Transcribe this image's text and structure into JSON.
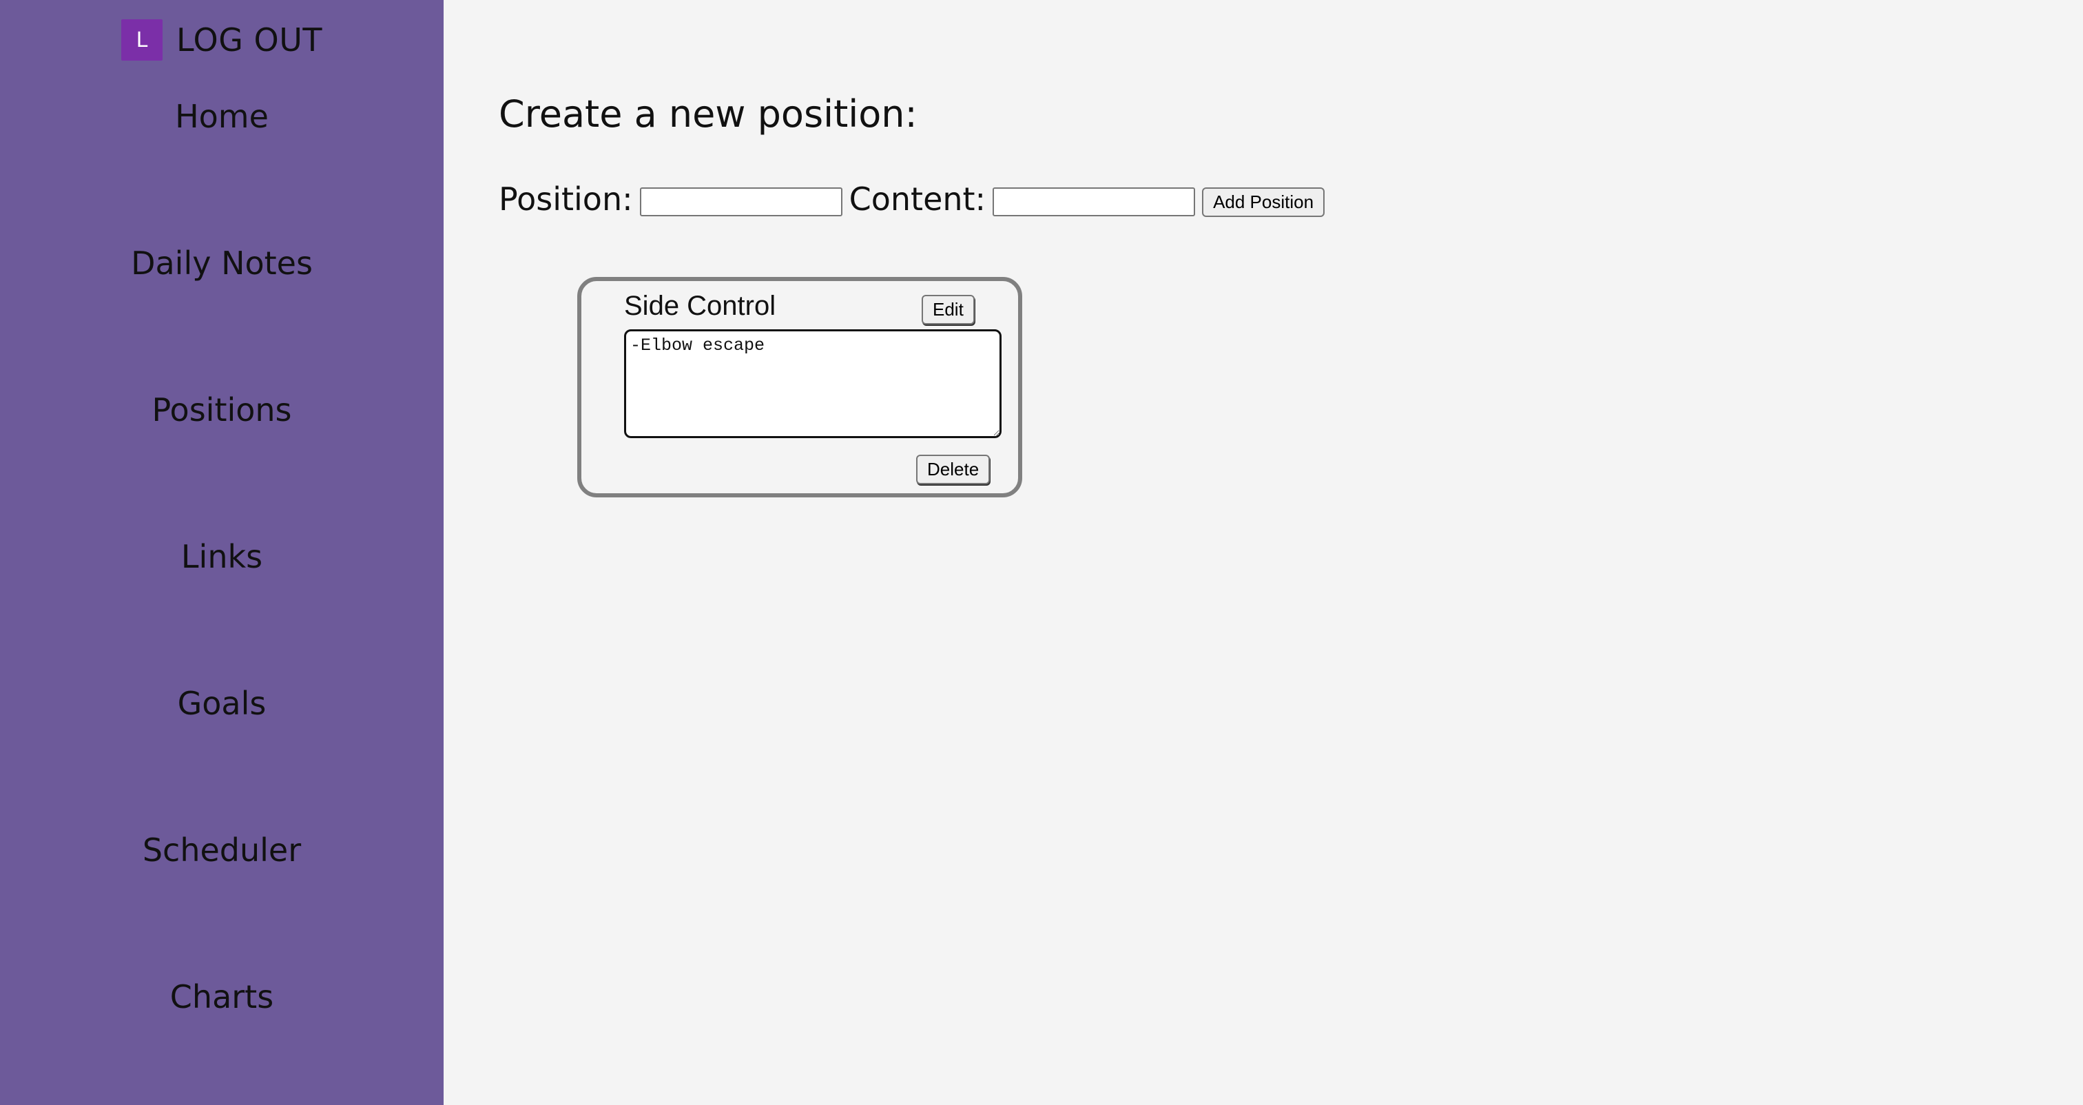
{
  "sidebar": {
    "avatar_letter": "L",
    "logout_label": "LOG OUT",
    "items": [
      {
        "label": "Home"
      },
      {
        "label": "Daily Notes"
      },
      {
        "label": "Positions"
      },
      {
        "label": "Links"
      },
      {
        "label": "Goals"
      },
      {
        "label": "Scheduler"
      },
      {
        "label": "Charts"
      }
    ]
  },
  "main": {
    "title": "Create a new position:",
    "form": {
      "position_label": "Position:",
      "position_value": "",
      "content_label": "Content:",
      "content_value": "",
      "add_button": "Add Position"
    },
    "positions": [
      {
        "title": "Side Control",
        "edit_label": "Edit",
        "content": "-Elbow escape",
        "delete_label": "Delete"
      }
    ]
  },
  "colors": {
    "sidebar_bg": "#6d5a9a",
    "avatar_bg": "#7b2fa8",
    "page_bg": "#f4f4f4",
    "card_border": "#808080"
  }
}
